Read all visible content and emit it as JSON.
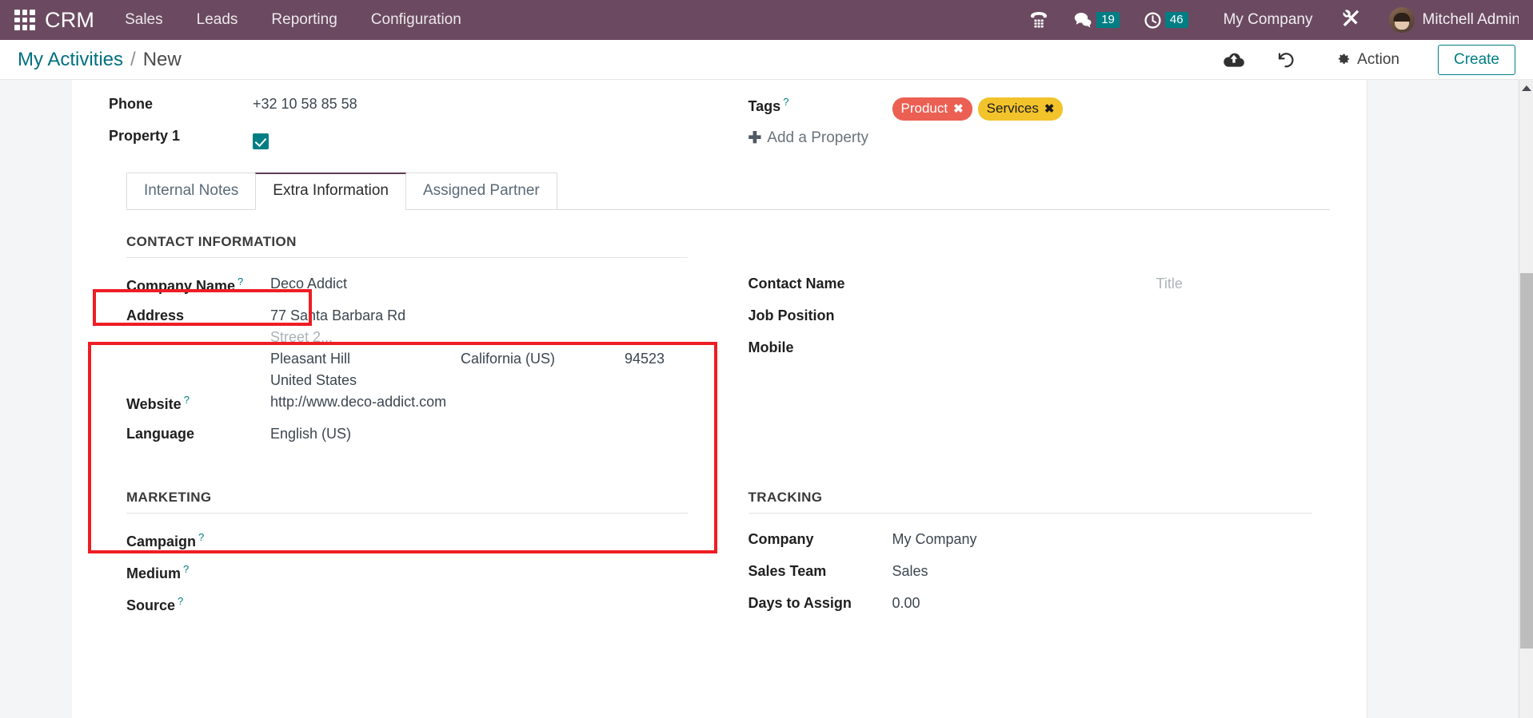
{
  "navbar": {
    "apps_icon": "apps-grid-icon",
    "brand": "CRM",
    "menus": [
      "Sales",
      "Leads",
      "Reporting",
      "Configuration"
    ],
    "phone_icon": "phone-icon",
    "messages_icon": "chat-bubble-icon",
    "messages_count": "19",
    "activities_icon": "clock-icon",
    "activities_count": "46",
    "company": "My Company",
    "tools_icon": "wrench-screwdriver-icon",
    "user": "Mitchell Admin",
    "bg_color": "#6b4a61",
    "badge_color": "#017e84"
  },
  "control_panel": {
    "breadcrumb_root": "My Activities",
    "breadcrumb_sep": "/",
    "breadcrumb_current": "New",
    "save_icon": "cloud-upload-icon",
    "discard_icon": "undo-icon",
    "action_icon": "gear-icon",
    "action_label": "Action",
    "create_label": "Create",
    "accent_color": "#017e84"
  },
  "form": {
    "top_fields": {
      "phone_label": "Phone",
      "phone_value": "+32 10 58 85 58",
      "property1_label": "Property 1",
      "property1_checked": true,
      "tags_label": "Tags",
      "tags": [
        {
          "label": "Product",
          "color": "#ec5f53"
        },
        {
          "label": "Services",
          "color": "#f2c32b"
        }
      ],
      "add_property_label": "Add a Property"
    },
    "tabs": [
      {
        "label": "Internal Notes",
        "active": false
      },
      {
        "label": "Extra Information",
        "active": true
      },
      {
        "label": "Assigned Partner",
        "active": false
      }
    ],
    "contact_information": {
      "section_title": "CONTACT INFORMATION",
      "company_name_label": "Company Name",
      "company_name_value": "Deco Addict",
      "address_label": "Address",
      "street": "77 Santa Barbara Rd",
      "street2_placeholder": "Street 2...",
      "city": "Pleasant Hill",
      "state": "California (US)",
      "zip": "94523",
      "country": "United States",
      "website_label": "Website",
      "website_value": "http://www.deco-addict.com",
      "language_label": "Language",
      "language_value": "English (US)",
      "contact_name_label": "Contact Name",
      "contact_name_value": "",
      "title_placeholder": "Title",
      "job_position_label": "Job Position",
      "job_position_value": "",
      "mobile_label": "Mobile",
      "mobile_value": ""
    },
    "marketing": {
      "section_title": "MARKETING",
      "campaign_label": "Campaign",
      "campaign_value": "",
      "medium_label": "Medium",
      "medium_value": "",
      "source_label": "Source",
      "source_value": ""
    },
    "tracking": {
      "section_title": "TRACKING",
      "company_label": "Company",
      "company_value": "My Company",
      "sales_team_label": "Sales Team",
      "sales_team_value": "Sales",
      "days_to_assign_label": "Days to Assign",
      "days_to_assign_value": "0.00"
    }
  },
  "annotations": {
    "highlight_color": "#ee1d24",
    "boxes": [
      {
        "name": "contact-information-heading-highlight"
      },
      {
        "name": "address-block-highlight"
      }
    ]
  }
}
